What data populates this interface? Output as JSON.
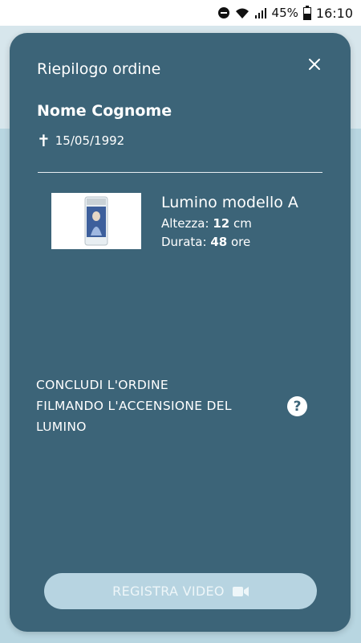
{
  "status_bar": {
    "battery": "45%",
    "time": "16:10",
    "icons": [
      "do-not-disturb-icon",
      "wifi-icon",
      "signal-icon",
      "battery-icon"
    ]
  },
  "order_summary": {
    "title": "Riepilogo ordine",
    "customer_name": "Nome Cognome",
    "death_date": "15/05/1992",
    "product": {
      "name": "Lumino modello A",
      "height_label": "Altezza:",
      "height_value": "12",
      "height_unit": "cm",
      "duration_label": "Durata:",
      "duration_value": "48",
      "duration_unit": "ore"
    },
    "cta_text_line1": "CONCLUDI L'ORDINE",
    "cta_text_line2": "FILMANDO L'ACCENSIONE DEL",
    "cta_text_line3": "LUMINO",
    "help_label": "?",
    "record_button_label": "REGISTRA VIDEO"
  },
  "colors": {
    "card_bg": "#3c6478",
    "button_bg": "#b7d4e1",
    "page_bg": "#a9cbd8"
  }
}
